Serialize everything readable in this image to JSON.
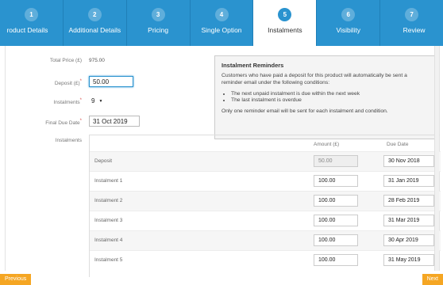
{
  "steps": [
    {
      "num": "1",
      "label": "roduct Details"
    },
    {
      "num": "2",
      "label": "Additional Details"
    },
    {
      "num": "3",
      "label": "Pricing"
    },
    {
      "num": "4",
      "label": "Single Option"
    },
    {
      "num": "5",
      "label": "Instalments"
    },
    {
      "num": "6",
      "label": "Visibility"
    },
    {
      "num": "7",
      "label": "Review"
    }
  ],
  "active_step": "5",
  "form": {
    "total_price_label": "Total Price (£)",
    "total_price_value": "975.00",
    "deposit_label": "Deposit (£)",
    "deposit_value": "50.00",
    "instalments_label": "Instalments",
    "instalments_value": "9",
    "final_due_label": "Final Due Date",
    "final_due_value": "31 Oct 2019",
    "instalments_table_label": "Instalments"
  },
  "reminder": {
    "title": "Instalment Reminders",
    "intro": "Customers who have paid a deposit for this product will automatically be sent a reminder email under the following conditions:",
    "bullets": [
      "The next unpaid instalment is due within the next week",
      "The last instalment is overdue"
    ],
    "footer": "Only one reminder email will be sent for each instalment and condition."
  },
  "table": {
    "col_amount": "Amount (£)",
    "col_due": "Due Date",
    "rows": [
      {
        "name": "Deposit",
        "amount": "50.00",
        "due": "30 Nov 2018"
      },
      {
        "name": "Instalment 1",
        "amount": "100.00",
        "due": "31 Jan 2019"
      },
      {
        "name": "Instalment 2",
        "amount": "100.00",
        "due": "28 Feb 2019"
      },
      {
        "name": "Instalment 3",
        "amount": "100.00",
        "due": "31 Mar 2019"
      },
      {
        "name": "Instalment 4",
        "amount": "100.00",
        "due": "30 Apr 2019"
      },
      {
        "name": "Instalment 5",
        "amount": "100.00",
        "due": "31 May 2019"
      }
    ]
  },
  "buttons": {
    "previous": "Previous",
    "next": "Next"
  },
  "colors": {
    "step_bar": "#2a93cf",
    "button": "#f5a623",
    "required": "#d9534f"
  }
}
